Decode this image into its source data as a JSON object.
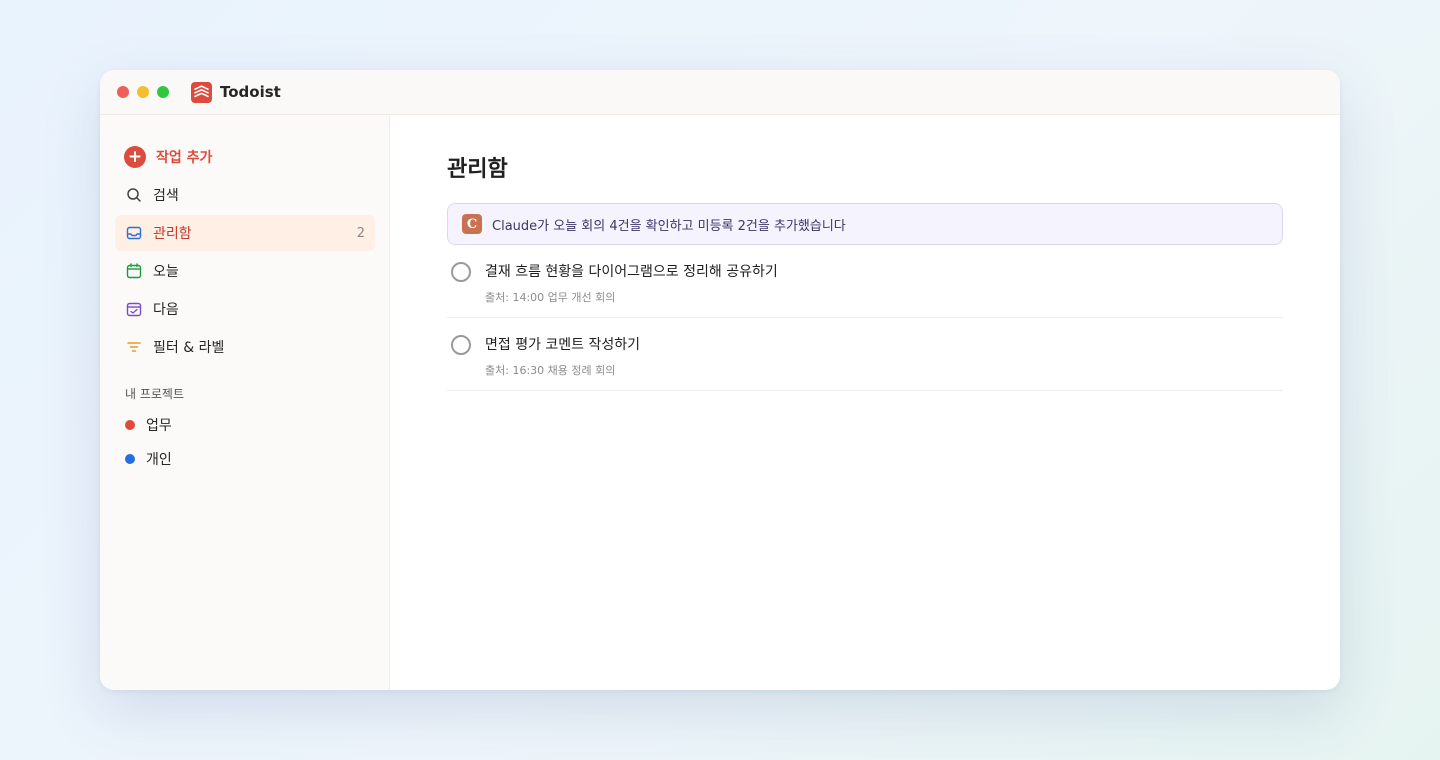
{
  "window": {
    "title": "Todoist"
  },
  "sidebar": {
    "add_task_label": "작업 추가",
    "items": [
      {
        "label": "검색",
        "icon": "search-icon"
      },
      {
        "label": "관리함",
        "icon": "inbox-icon",
        "count": "2",
        "active": true
      },
      {
        "label": "오늘",
        "icon": "calendar-today-icon"
      },
      {
        "label": "다음",
        "icon": "calendar-upcoming-icon"
      },
      {
        "label": "필터 & 라벨",
        "icon": "filter-icon"
      }
    ],
    "projects_heading": "내 프로젝트",
    "projects": [
      {
        "name": "업무",
        "color": "#dc4c3e"
      },
      {
        "name": "개인",
        "color": "#246fe0"
      }
    ]
  },
  "main": {
    "title": "관리함",
    "banner": {
      "logo_letter": "C",
      "text": "Claude가 오늘 회의 4건을 확인하고 미등록 2건을 추가했습니다"
    },
    "tasks": [
      {
        "title": "결재 흐름 현황을 다이어그램으로 정리해 공유하기",
        "meta": "출처: 14:00 업무 개선 회의"
      },
      {
        "title": "면접 평가 코멘트 작성하기",
        "meta": "출처: 16:30 채용 정례 회의"
      }
    ]
  },
  "colors": {
    "accent": "#dc4c3e",
    "active_bg": "#ffefe5",
    "banner_bg": "#f5f3fd",
    "claude_logo": "#c9724f"
  }
}
